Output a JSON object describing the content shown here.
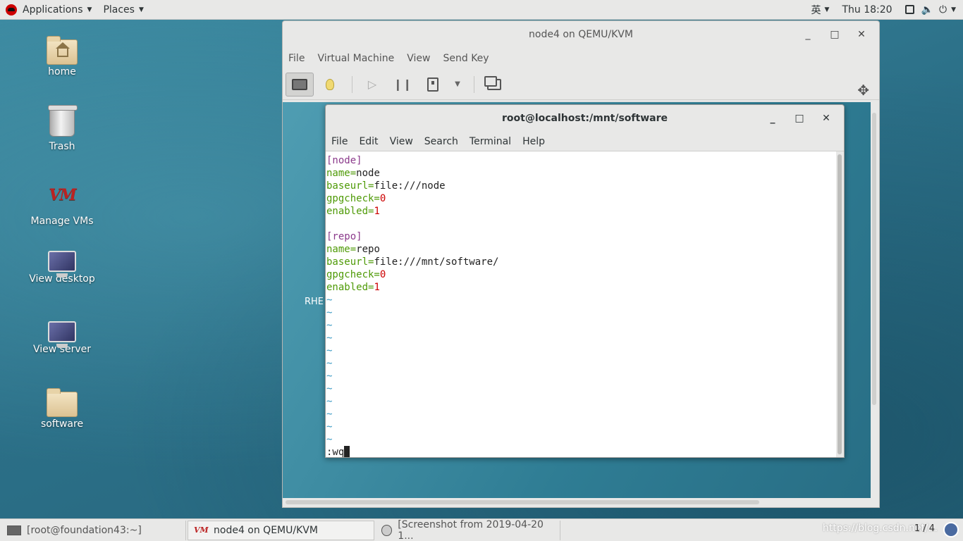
{
  "topbar": {
    "applications": "Applications",
    "places": "Places",
    "input_method": "英",
    "clock": "Thu 18:20"
  },
  "desktop": {
    "icons": [
      {
        "label": "home",
        "icon": "home-folder-icon"
      },
      {
        "label": "Trash",
        "icon": "trash-icon"
      },
      {
        "label": "Manage VMs",
        "icon": "virt-manager-icon"
      },
      {
        "label": "View desktop",
        "icon": "monitor-icon"
      },
      {
        "label": "View server",
        "icon": "monitor-icon"
      },
      {
        "label": "software",
        "icon": "folder-icon"
      }
    ]
  },
  "vm_window": {
    "title": "node4 on QEMU/KVM",
    "menu": [
      "File",
      "Virtual Machine",
      "View",
      "Send Key"
    ],
    "guest_text": "RHE"
  },
  "terminal": {
    "title": "root@localhost:/mnt/software",
    "menu": [
      "File",
      "Edit",
      "View",
      "Search",
      "Terminal",
      "Help"
    ],
    "lines": {
      "l1": "[node]",
      "l2_key": "name=",
      "l2_val": "node",
      "l3_key": "baseurl=",
      "l3_val": "file:///node",
      "l4_key": "gpgcheck=",
      "l4_val": "0",
      "l5_key": "enabled=",
      "l5_val": "1",
      "l7": "[repo]",
      "l8_key": "name=",
      "l8_val": "repo",
      "l9_key": "baseurl=",
      "l9_val": "file:///mnt/software/",
      "l10_key": "gpgcheck=",
      "l10_val": "0",
      "l11_key": "enabled=",
      "l11_val": "1",
      "tilde": "~",
      "command": ":wq"
    }
  },
  "taskbar": {
    "task1": "[root@foundation43:~]",
    "task2": "node4 on QEMU/KVM",
    "task3": "[Screenshot from 2019-04-20 1...",
    "workspace": "1 / 4",
    "watermark": "https://blog.csdn.net/..."
  },
  "colors": {
    "section": "#8b3a8b",
    "key": "#4e9a06",
    "number": "#cc0000",
    "tilde": "#3b9ac4"
  }
}
